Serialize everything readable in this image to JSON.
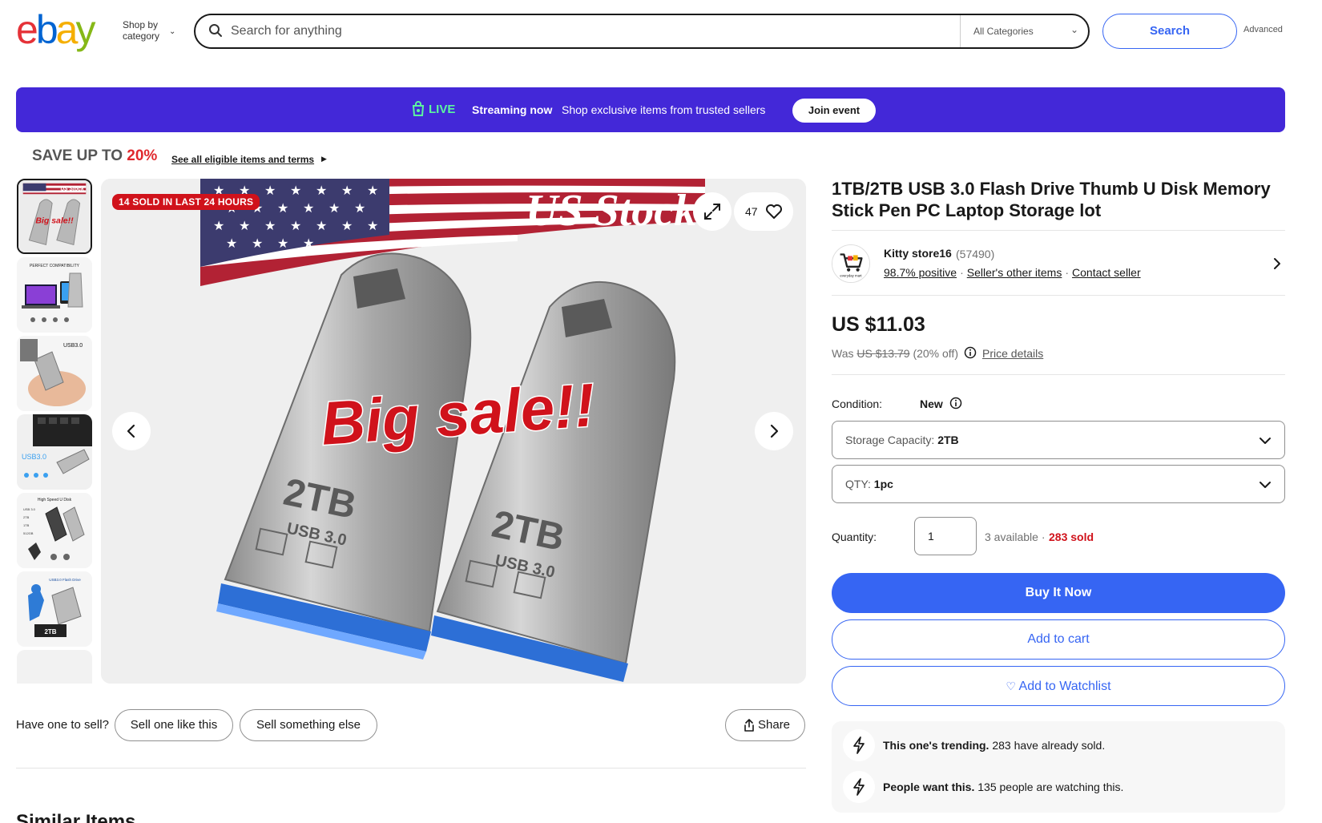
{
  "header": {
    "logo": {
      "e": "e",
      "b": "b",
      "a": "a",
      "y": "y"
    },
    "shop_by_category": "Shop by category",
    "search": {
      "placeholder": "Search for anything",
      "value": "",
      "category": "All Categories"
    },
    "search_button": "Search",
    "advanced_link": "Advanced"
  },
  "live_banner": {
    "live_label": "LIVE",
    "streaming_now": "Streaming now",
    "description": "Shop exclusive items from trusted sellers",
    "join_button": "Join event",
    "background_color": "#4328d8",
    "live_color": "#5cf59f"
  },
  "promo": {
    "save_text": "SAVE UP TO",
    "save_percent": "20%",
    "link_text": "See all eligible items and terms"
  },
  "gallery": {
    "thumbnail_count": 6,
    "selected_index": 0,
    "sold_badge": "14 SOLD IN LAST 24 HOURS",
    "watch_count": "47",
    "image_texts": {
      "us_stock": "US Stock",
      "big_sale": "Big sale!!",
      "capacity_label": "2TB",
      "usb_label": "USB 3.0"
    },
    "thumb_texts": {
      "thumb1_stock": "US Stock",
      "thumb1_sale": "Big sale!!",
      "thumb2_heading": "PERFECT COMPATIBILITY",
      "thumb3_heading": "USB3.0",
      "thumb4_heading": "USB3.0",
      "thumb5_heading": "High Speed U Disk",
      "thumb5_caps": [
        "USB 3.0",
        "2TB",
        "1TB",
        "512GB"
      ],
      "thumb6_heading": "USB3.0 Flash Drive",
      "thumb6_cap": "2TB"
    }
  },
  "sell_row": {
    "prompt": "Have one to sell?",
    "sell_like": "Sell one like this",
    "sell_else": "Sell something else",
    "share": "Share"
  },
  "similar_heading": "Similar Items",
  "listing": {
    "title": "1TB/2TB USB 3.0 Flash Drive Thumb U Disk Memory Stick Pen PC Laptop Storage lot",
    "seller": {
      "name": "Kitty store16",
      "feedback_count": "(57490)",
      "positive": "98.7% positive",
      "other_items": "Seller's other items",
      "contact": "Contact seller",
      "avatar_caption": "everyday mart"
    },
    "price": "US $11.03",
    "was_label": "Was",
    "was_price": "US $13.79",
    "discount": "(20% off)",
    "price_details": "Price details",
    "condition_label": "Condition:",
    "condition_value": "New",
    "variations": [
      {
        "label": "Storage Capacity:",
        "value": "2TB"
      },
      {
        "label": "QTY:",
        "value": "1pc"
      }
    ],
    "quantity_label": "Quantity:",
    "quantity_value": "1",
    "available": "3 available",
    "sold": "283 sold",
    "buy_now": "Buy It Now",
    "add_to_cart": "Add to cart",
    "add_to_watchlist": "Add to Watchlist",
    "accent_color": "#3665f3",
    "sold_color": "#d0121b"
  },
  "trends": [
    {
      "bold": "This one's trending.",
      "text": "283 have already sold."
    },
    {
      "bold": "People want this.",
      "text": "135 people are watching this."
    }
  ]
}
